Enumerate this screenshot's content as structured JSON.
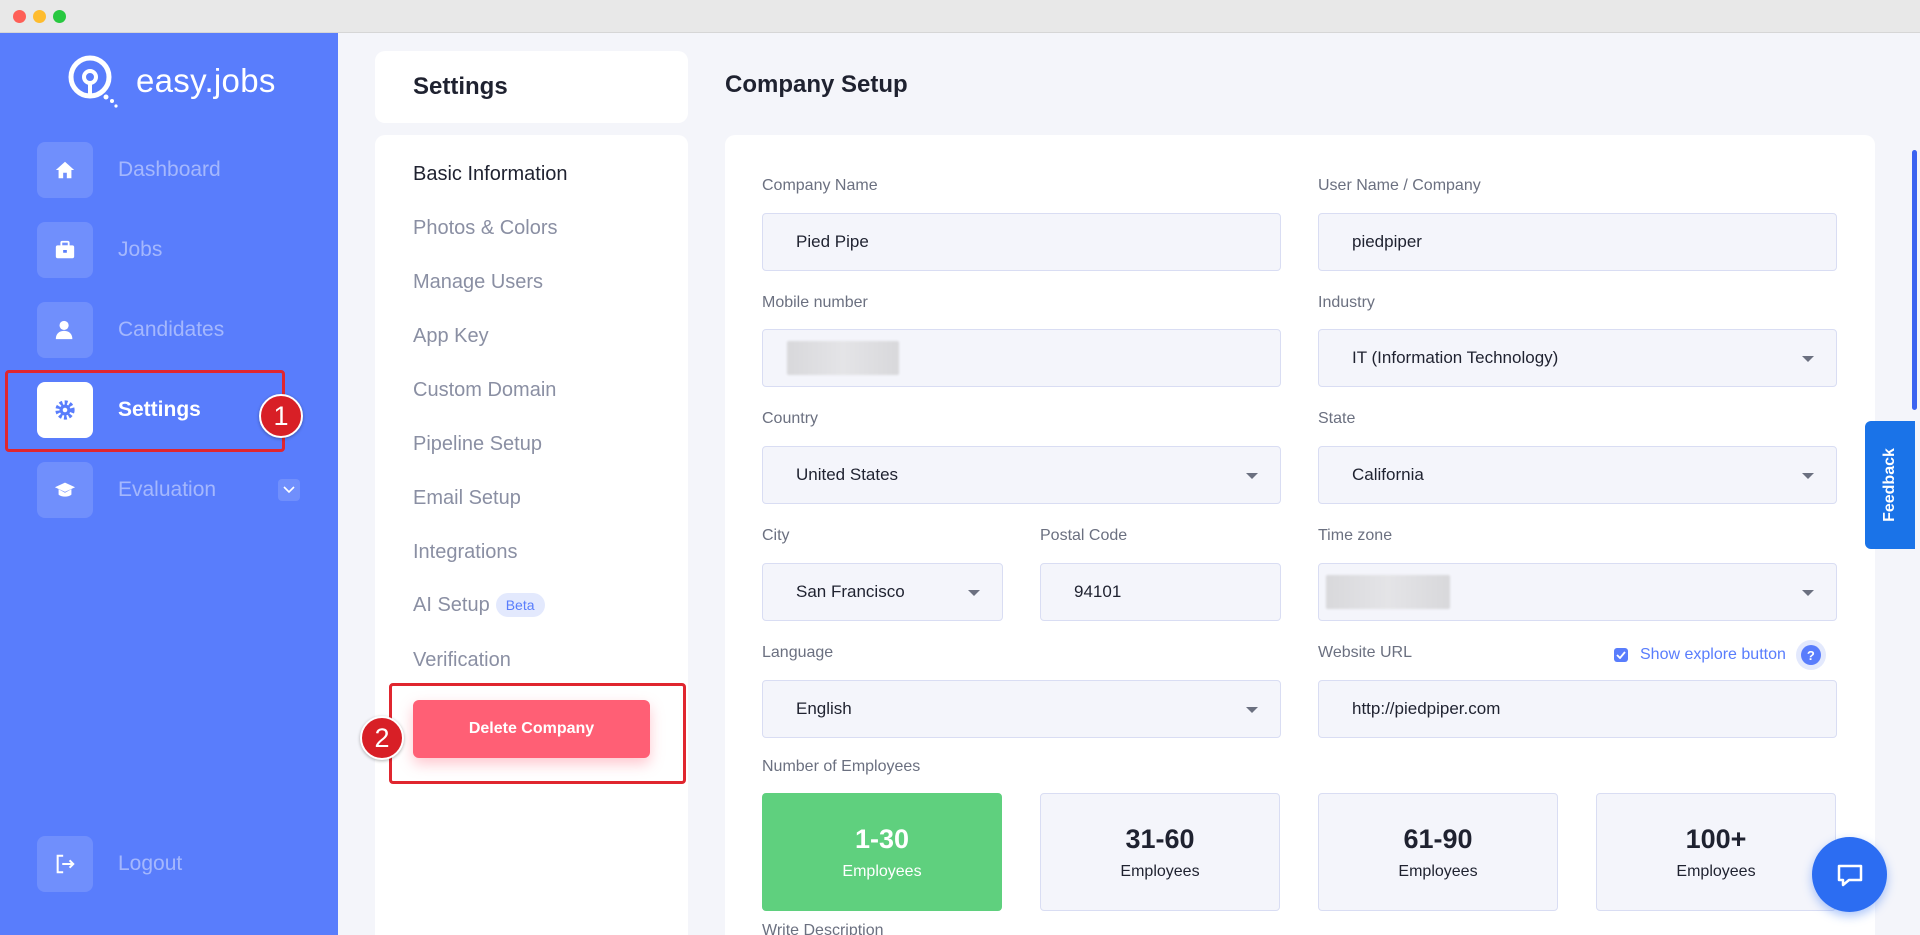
{
  "app": {
    "logo_text": "easy.jobs"
  },
  "sidebar": {
    "items": [
      {
        "label": "Dashboard"
      },
      {
        "label": "Jobs"
      },
      {
        "label": "Candidates"
      },
      {
        "label": "Settings"
      },
      {
        "label": "Evaluation"
      }
    ],
    "logout_label": "Logout"
  },
  "annotations": {
    "step1": "1",
    "step2": "2"
  },
  "settings": {
    "title": "Settings",
    "menu": [
      {
        "label": "Basic Information"
      },
      {
        "label": "Photos & Colors"
      },
      {
        "label": "Manage Users"
      },
      {
        "label": "App Key"
      },
      {
        "label": "Custom Domain"
      },
      {
        "label": "Pipeline Setup"
      },
      {
        "label": "Email Setup"
      },
      {
        "label": "Integrations"
      },
      {
        "label": "AI Setup",
        "badge": "Beta"
      },
      {
        "label": "Verification"
      }
    ],
    "delete_label": "Delete Company"
  },
  "form": {
    "title": "Company Setup",
    "company_name": {
      "label": "Company Name",
      "value": "Pied Pipe"
    },
    "username": {
      "label": "User Name / Company",
      "value": "piedpiper"
    },
    "mobile": {
      "label": "Mobile number"
    },
    "industry": {
      "label": "Industry",
      "value": "IT (Information Technology)"
    },
    "country": {
      "label": "Country",
      "value": "United States"
    },
    "state": {
      "label": "State",
      "value": "California"
    },
    "city": {
      "label": "City",
      "value": "San Francisco"
    },
    "postal": {
      "label": "Postal Code",
      "value": "94101"
    },
    "timezone": {
      "label": "Time zone"
    },
    "language": {
      "label": "Language",
      "value": "English"
    },
    "website": {
      "label": "Website URL",
      "value": "http://piedpiper.com",
      "explore_label": "Show explore button",
      "explore_checked": true
    },
    "employees": {
      "label": "Number of Employees",
      "options": [
        {
          "range": "1-30",
          "unit": "Employees",
          "selected": true
        },
        {
          "range": "31-60",
          "unit": "Employees"
        },
        {
          "range": "61-90",
          "unit": "Employees"
        },
        {
          "range": "100+",
          "unit": "Employees"
        }
      ]
    },
    "description_label": "Write Description"
  },
  "feedback_label": "Feedback",
  "colors": {
    "sidebar": "#597dfc",
    "delete": "#ff5f75",
    "selected": "#5fd07e",
    "highlight": "#e0262f"
  }
}
